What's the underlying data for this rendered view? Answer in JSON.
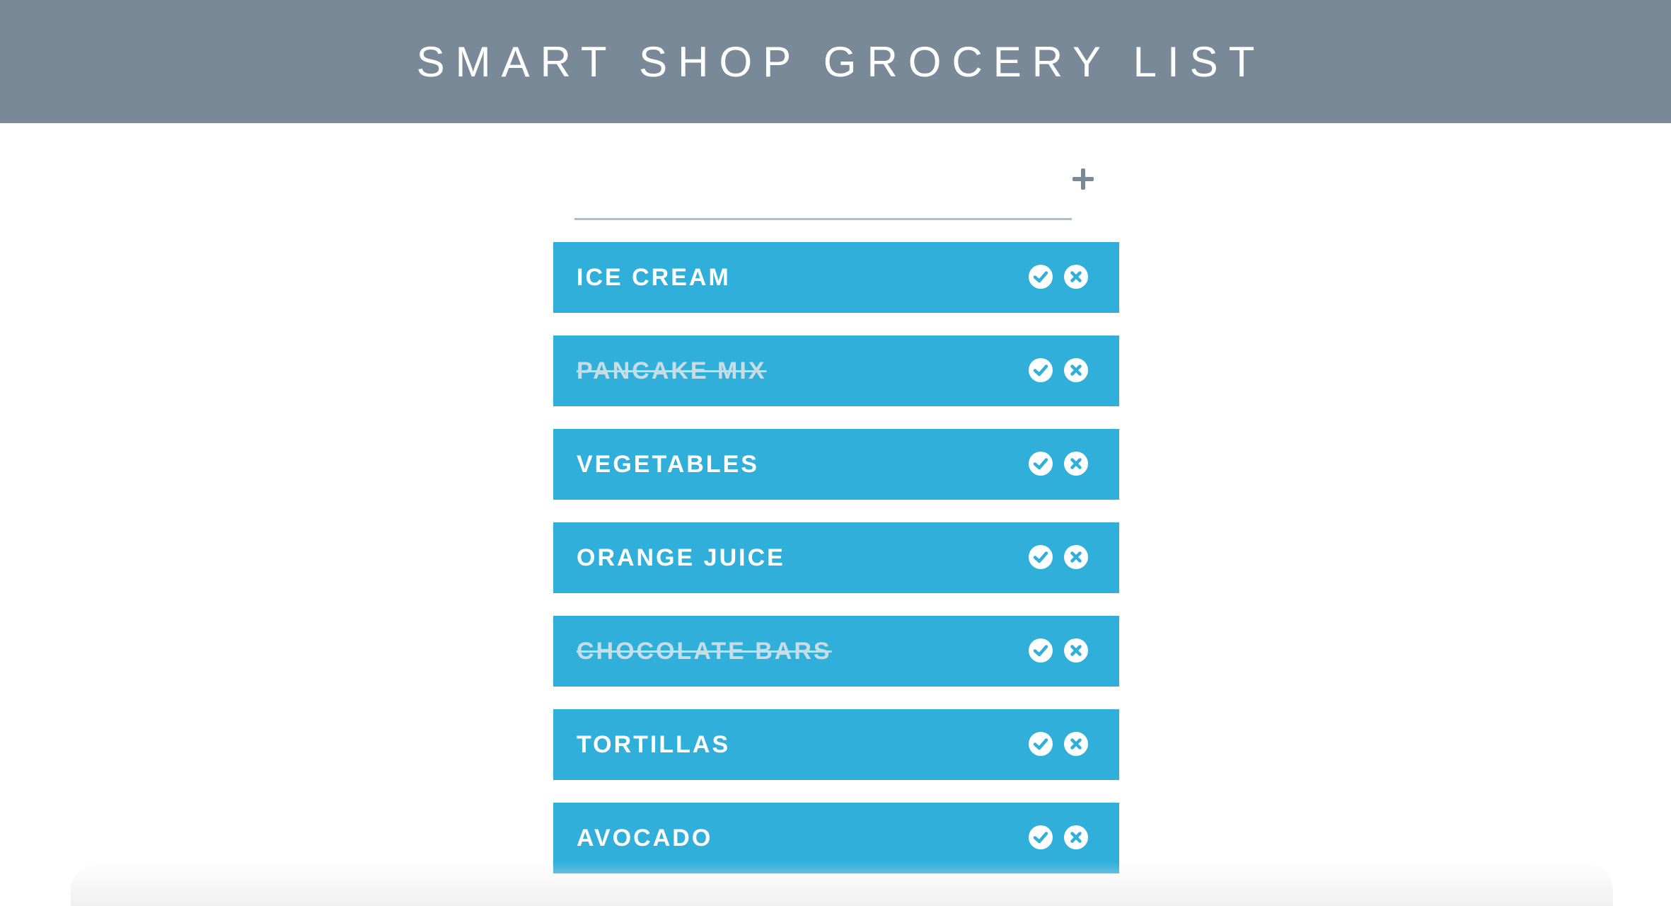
{
  "header": {
    "title": "SMART SHOP GROCERY LIST"
  },
  "add_form": {
    "value": "",
    "placeholder": "",
    "add_icon": "plus-icon"
  },
  "colors": {
    "header_bg": "#798998",
    "item_bg": "#31afdb",
    "checked_text": "#c7dde6"
  },
  "items": [
    {
      "label": "ICE CREAM",
      "checked": false
    },
    {
      "label": "PANCAKE MIX",
      "checked": true
    },
    {
      "label": "VEGETABLES",
      "checked": false
    },
    {
      "label": "ORANGE JUICE",
      "checked": false
    },
    {
      "label": "CHOCOLATE BARS",
      "checked": true
    },
    {
      "label": "TORTILLAS",
      "checked": false
    },
    {
      "label": "AVOCADO",
      "checked": false
    }
  ],
  "item_icons": {
    "check": "check-circle-icon",
    "delete": "x-circle-icon"
  }
}
